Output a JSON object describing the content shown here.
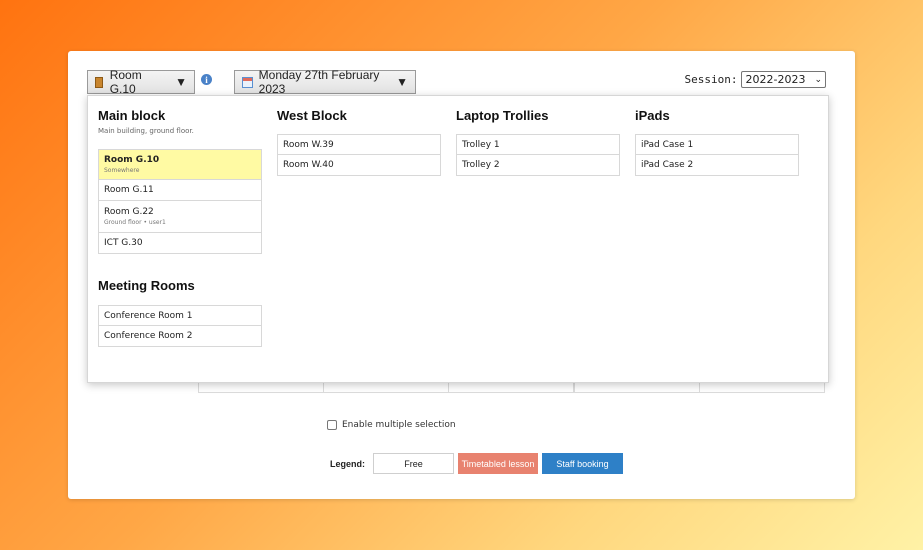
{
  "toolbar": {
    "room_label": "Room G.10",
    "date_label": "Monday 27th February 2023",
    "session_label": "Session:",
    "session_value": "2022-2023"
  },
  "groups": [
    {
      "title": "Main block",
      "description": "Main building, ground floor.",
      "items": [
        {
          "name": "Room G.10",
          "sub": "Somewhere",
          "selected": true
        },
        {
          "name": "Room G.11",
          "sub": ""
        },
        {
          "name": "Room G.22",
          "sub": "Ground floor • user1"
        },
        {
          "name": "ICT G.30",
          "sub": ""
        }
      ]
    },
    {
      "title": "West Block",
      "description": "",
      "items": [
        {
          "name": "Room W.39",
          "sub": ""
        },
        {
          "name": "Room W.40",
          "sub": ""
        }
      ]
    },
    {
      "title": "Laptop Trollies",
      "description": "",
      "items": [
        {
          "name": "Trolley 1",
          "sub": ""
        },
        {
          "name": "Trolley 2",
          "sub": ""
        }
      ]
    },
    {
      "title": "iPads",
      "description": "",
      "items": [
        {
          "name": "iPad Case 1",
          "sub": ""
        },
        {
          "name": "iPad Case 2",
          "sub": ""
        }
      ]
    },
    {
      "title": "Meeting Rooms",
      "description": "",
      "items": [
        {
          "name": "Conference Room 1",
          "sub": ""
        },
        {
          "name": "Conference Room 2",
          "sub": ""
        }
      ]
    }
  ],
  "multi_select_label": "Enable multiple selection",
  "legend": {
    "label": "Legend:",
    "items": [
      {
        "text": "Free",
        "bg": "#ffffff",
        "fg": "#222222"
      },
      {
        "text": "Timetabled lesson",
        "bg": "#e8826f",
        "fg": "#ffffff"
      },
      {
        "text": "Staff booking",
        "bg": "#2e80c7",
        "fg": "#ffffff"
      }
    ]
  },
  "colors": {
    "selected_item": "#fffaa3",
    "info_icon": "#4a82c8"
  }
}
